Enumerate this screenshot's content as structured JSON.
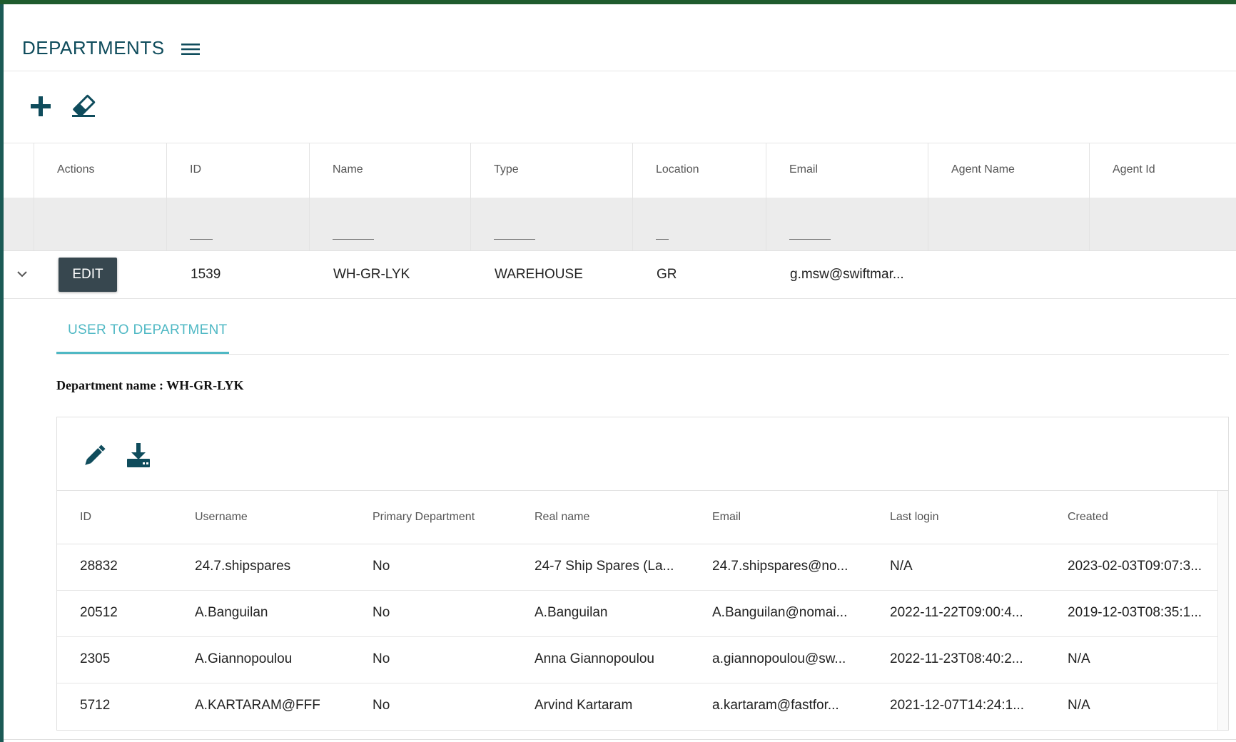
{
  "header": {
    "title": "DEPARTMENTS"
  },
  "colors": {
    "accent": "#0f4c5c",
    "tab_active": "#4fb8c4",
    "edit_button": "#37474f",
    "top_bar": "#1f5c2e"
  },
  "toolbar": {
    "add_icon": "plus-icon",
    "clear_icon": "eraser-icon"
  },
  "grid": {
    "columns": [
      "Actions",
      "ID",
      "Name",
      "Type",
      "Location",
      "Email",
      "Agent Name",
      "Agent Id"
    ],
    "row": {
      "edit_label": "EDIT",
      "id": "1539",
      "name": "WH-GR-LYK",
      "type": "WAREHOUSE",
      "location": "GR",
      "email": "g.msw@swiftmar...",
      "agent_name": "",
      "agent_id": ""
    }
  },
  "detail": {
    "tab_label": "USER TO DEPARTMENT",
    "department_name": "Department name : WH-GR-LYK",
    "toolbar": {
      "edit_icon": "pencil-icon",
      "download_icon": "download-icon"
    },
    "columns": [
      "ID",
      "Username",
      "Primary Department",
      "Real name",
      "Email",
      "Last login",
      "Created"
    ],
    "rows": [
      [
        "28832",
        "24.7.shipspares",
        "No",
        "24-7 Ship Spares (La...",
        "24.7.shipspares@no...",
        "N/A",
        "2023-02-03T09:07:3..."
      ],
      [
        "20512",
        "A.Banguilan",
        "No",
        "A.Banguilan",
        "A.Banguilan@nomai...",
        "2022-11-22T09:00:4...",
        "2019-12-03T08:35:1..."
      ],
      [
        "2305",
        "A.Giannopoulou",
        "No",
        "Anna Giannopoulou",
        "a.giannopoulou@sw...",
        "2022-11-23T08:40:2...",
        "N/A"
      ],
      [
        "5712",
        "A.KARTARAM@FFF",
        "No",
        "Arvind Kartaram",
        "a.kartaram@fastfor...",
        "2021-12-07T14:24:1...",
        "N/A"
      ]
    ]
  }
}
